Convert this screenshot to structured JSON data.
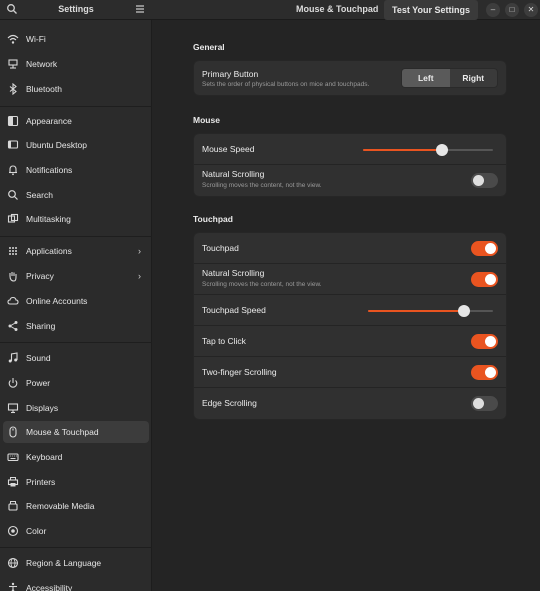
{
  "sidebar_header": {
    "title": "Settings"
  },
  "main_header": {
    "title": "Mouse & Touchpad",
    "test_button": "Test Your Settings"
  },
  "sidebar": {
    "items": [
      {
        "label": "Wi-Fi",
        "icon": "wifi-icon"
      },
      {
        "label": "Network",
        "icon": "network-icon"
      },
      {
        "label": "Bluetooth",
        "icon": "bluetooth-icon"
      },
      {
        "label": "Appearance",
        "icon": "appearance-icon"
      },
      {
        "label": "Ubuntu Desktop",
        "icon": "desktop-icon"
      },
      {
        "label": "Notifications",
        "icon": "bell-icon"
      },
      {
        "label": "Search",
        "icon": "search-icon"
      },
      {
        "label": "Multitasking",
        "icon": "multitasking-icon"
      },
      {
        "label": "Applications",
        "icon": "apps-icon"
      },
      {
        "label": "Privacy",
        "icon": "hand-icon"
      },
      {
        "label": "Online Accounts",
        "icon": "cloud-icon"
      },
      {
        "label": "Sharing",
        "icon": "share-icon"
      },
      {
        "label": "Sound",
        "icon": "music-note-icon"
      },
      {
        "label": "Power",
        "icon": "power-icon"
      },
      {
        "label": "Displays",
        "icon": "monitor-icon"
      },
      {
        "label": "Mouse & Touchpad",
        "icon": "mouse-icon"
      },
      {
        "label": "Keyboard",
        "icon": "keyboard-icon"
      },
      {
        "label": "Printers",
        "icon": "printer-icon"
      },
      {
        "label": "Removable Media",
        "icon": "usb-drive-icon"
      },
      {
        "label": "Color",
        "icon": "palette-icon"
      },
      {
        "label": "Region & Language",
        "icon": "globe-icon"
      },
      {
        "label": "Accessibility",
        "icon": "accessibility-icon"
      }
    ]
  },
  "general": {
    "title": "General",
    "primary_button": {
      "label": "Primary Button",
      "subtitle": "Sets the order of physical buttons on mice and touchpads.",
      "options": [
        "Left",
        "Right"
      ],
      "selected": "Left"
    }
  },
  "mouse": {
    "title": "Mouse",
    "speed": {
      "label": "Mouse Speed",
      "value_fraction": 0.61
    },
    "natural_scrolling": {
      "label": "Natural Scrolling",
      "subtitle": "Scrolling moves the content, not the view.",
      "on": false
    }
  },
  "touchpad": {
    "title": "Touchpad",
    "touchpad": {
      "label": "Touchpad",
      "on": true
    },
    "natural_scrolling": {
      "label": "Natural Scrolling",
      "subtitle": "Scrolling moves the content, not the view.",
      "on": true
    },
    "speed": {
      "label": "Touchpad Speed",
      "value_fraction": 0.77
    },
    "tap_to_click": {
      "label": "Tap to Click",
      "on": true
    },
    "two_finger_scrolling": {
      "label": "Two-finger Scrolling",
      "on": true
    },
    "edge_scrolling": {
      "label": "Edge Scrolling",
      "on": false
    }
  },
  "colors": {
    "accent": "#e95420",
    "background": "#242424",
    "sidebar": "#2b2b2b",
    "panel": "#303030"
  }
}
